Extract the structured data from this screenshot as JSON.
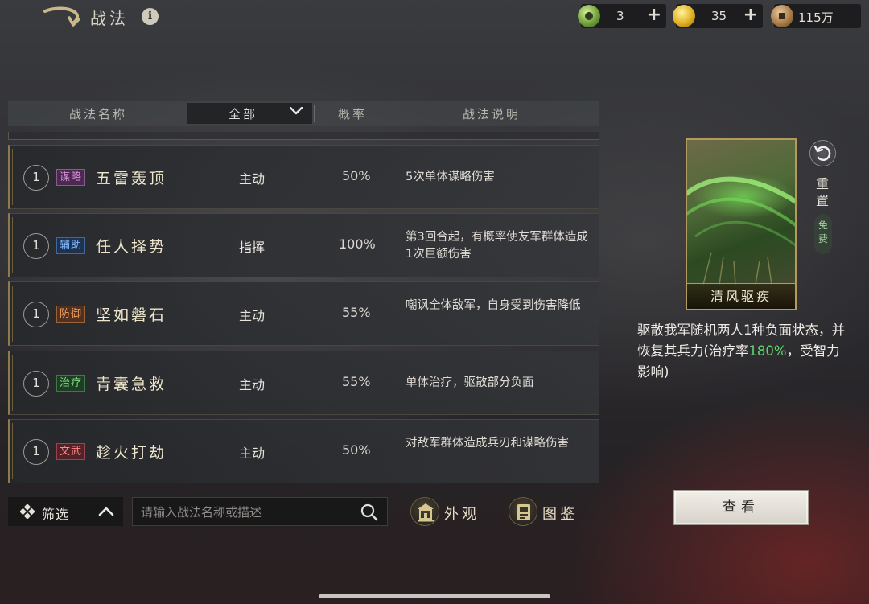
{
  "header": {
    "title": "战法",
    "info_icon": "info-icon",
    "back_icon": "back-arrow-icon",
    "currencies": [
      {
        "name": "jade",
        "value": "3",
        "has_plus": true,
        "icon": "jade-coin-icon"
      },
      {
        "name": "gold",
        "value": "35",
        "has_plus": true,
        "icon": "gold-coin-icon"
      },
      {
        "name": "copper",
        "value": "115万",
        "has_plus": false,
        "icon": "copper-coin-icon"
      }
    ]
  },
  "table": {
    "headers": {
      "name": "战法名称",
      "filter": "全部",
      "rate": "概率",
      "desc": "战法说明"
    },
    "rows": [
      {
        "level": "1",
        "tag": "谋略",
        "tag_color": "#d88fd8",
        "name": "五雷轰顶",
        "type": "主动",
        "rate": "50%",
        "desc": "5次单体谋略伤害"
      },
      {
        "level": "1",
        "tag": "辅助",
        "tag_color": "#7fb8ff",
        "name": "任人择势",
        "type": "指挥",
        "rate": "100%",
        "desc": "第3回合起，有概率使友军群体造成1次巨额伤害"
      },
      {
        "level": "1",
        "tag": "防御",
        "tag_color": "#f0a060",
        "name": "坚如磐石",
        "type": "主动",
        "rate": "55%",
        "desc": "嘲讽全体敌军，自身受到伤害降低"
      },
      {
        "level": "1",
        "tag": "治疗",
        "tag_color": "#7fdc7f",
        "name": "青囊急救",
        "type": "主动",
        "rate": "55%",
        "desc": "单体治疗，驱散部分负面"
      },
      {
        "level": "1",
        "tag": "文武",
        "tag_color": "#ff8a8a",
        "name": "趁火打劫",
        "type": "主动",
        "rate": "50%",
        "desc": "对敌军群体造成兵刃和谋略伤害"
      }
    ]
  },
  "bottom": {
    "filter_label": "筛选",
    "search_placeholder": "请输入战法名称或描述",
    "appearance_label": "外观",
    "codex_label": "图鉴"
  },
  "detail": {
    "card_name": "清风驱疾",
    "reset_label": "重置",
    "free_label": "免费",
    "desc_part1": "驱散我军随机两人1种负面状态，并恢复其兵力(治疗率",
    "desc_highlight": "180%",
    "desc_part2": "，受智力影响)",
    "highlight_color": "#5ed66e",
    "view_button": "查看"
  }
}
